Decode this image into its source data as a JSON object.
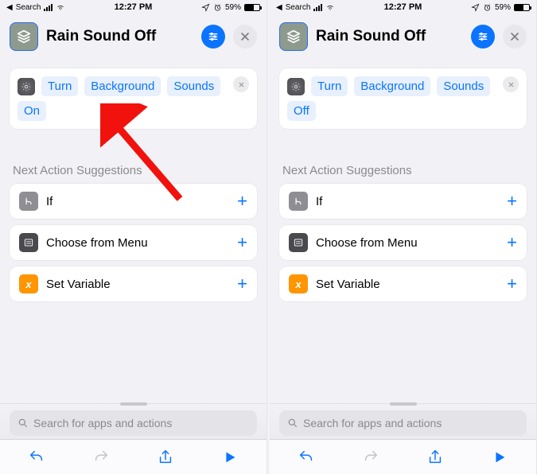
{
  "status": {
    "back_label": "Search",
    "time": "12:27 PM",
    "battery_pct": "59%"
  },
  "header": {
    "title": "Rain Sound Off"
  },
  "action": {
    "tokens_left": [
      "Turn",
      "Background",
      "Sounds",
      "On"
    ],
    "tokens_right": [
      "Turn",
      "Background",
      "Sounds",
      "Off"
    ]
  },
  "suggestions_header": "Next Action Suggestions",
  "suggestions": [
    {
      "label": "If"
    },
    {
      "label": "Choose from Menu"
    },
    {
      "label": "Set Variable"
    }
  ],
  "search": {
    "placeholder": "Search for apps and actions"
  }
}
